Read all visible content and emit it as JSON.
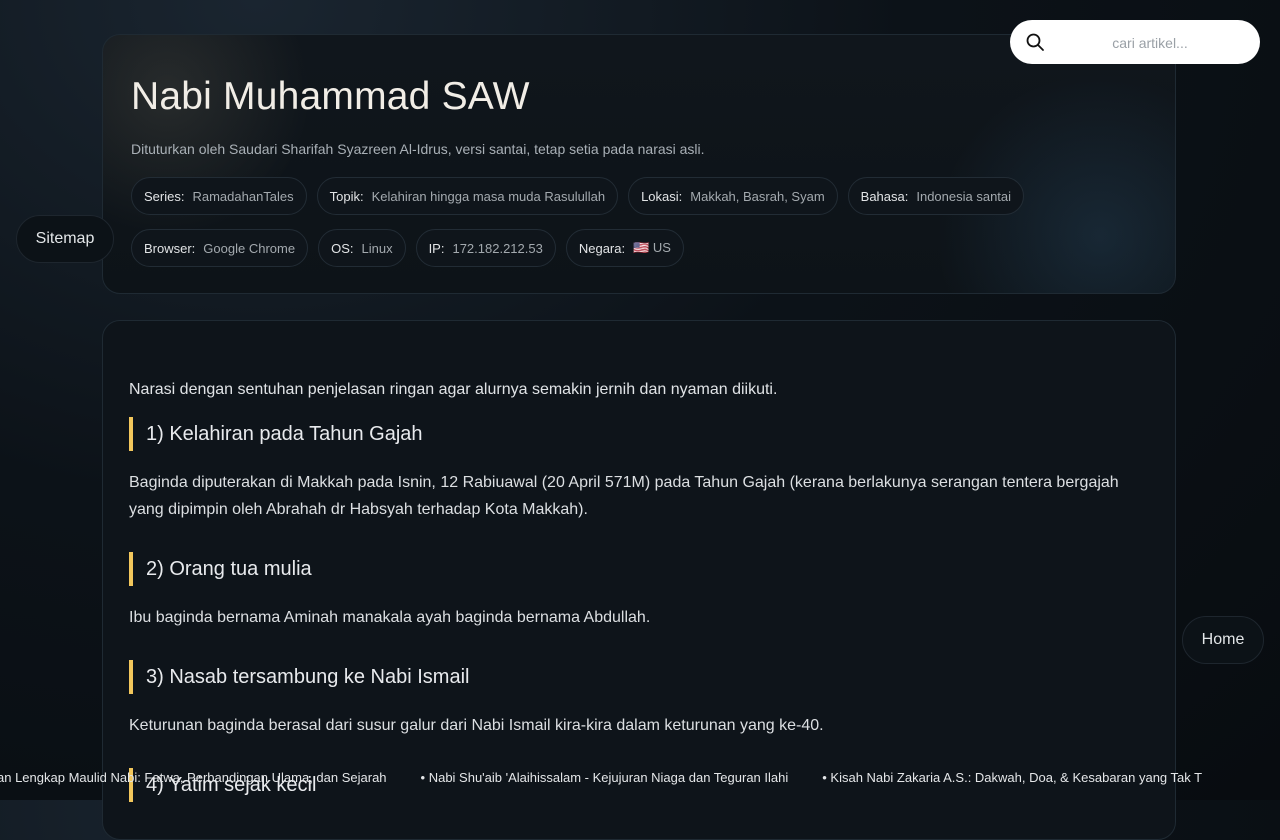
{
  "header": {
    "title": "Nabi Muhammad SAW",
    "subtitle": "Dituturkan oleh Saudari Sharifah Syazreen Al-Idrus, versi santai, tetap setia pada narasi asli.",
    "chips_row1": [
      {
        "key": "Series:",
        "value": "RamadahanTales"
      },
      {
        "key": "Topik:",
        "value": "Kelahiran hingga masa muda Rasulullah"
      },
      {
        "key": "Lokasi:",
        "value": "Makkah, Basrah, Syam"
      },
      {
        "key": "Bahasa:",
        "value": "Indonesia santai"
      }
    ],
    "chips_row2": [
      {
        "key": "Browser:",
        "value": "Google Chrome"
      },
      {
        "key": "OS:",
        "value": "Linux"
      },
      {
        "key": "IP:",
        "value": "172.182.212.53"
      },
      {
        "key": "Negara:",
        "value": "🇺🇸 US"
      }
    ]
  },
  "search": {
    "placeholder": "cari artikel...",
    "icon": "search-icon"
  },
  "nav": {
    "sitemap_label": "Sitemap",
    "home_label": "Home"
  },
  "content": {
    "intro": "Narasi dengan sentuhan penjelasan ringan agar alurnya semakin jernih dan nyaman diikuti.",
    "accent_color": "#f2c75c",
    "sections": [
      {
        "title": "1) Kelahiran pada Tahun Gajah",
        "text": "Baginda diputerakan di Makkah pada Isnin, 12 Rabiuawal (20 April 571M) pada Tahun Gajah (kerana berlakunya serangan tentera bergajah yang dipimpin oleh Abrahah dr Habsyah terhadap Kota Makkah)."
      },
      {
        "title": "2) Orang tua mulia",
        "text": "Ibu baginda bernama Aminah manakala ayah baginda bernama Abdullah."
      },
      {
        "title": "3) Nasab tersambung ke Nabi Ismail",
        "text": "Keturunan baginda berasal dari susur galur dari Nabi Ismail kira-kira dalam keturunan yang ke-40."
      },
      {
        "title": "4) Yatim sejak kecil",
        "text": ""
      }
    ]
  },
  "ticker": [
    "ajian Lengkap Maulid Nabi: Fatwa, Perbandingan Ulama, dan Sejarah",
    "• Nabi Shu'aib 'Alaihissalam - Kejujuran Niaga dan Teguran Ilahi",
    "• Kisah Nabi Zakaria A.S.: Dakwah, Doa, & Kesabaran yang Tak T"
  ]
}
